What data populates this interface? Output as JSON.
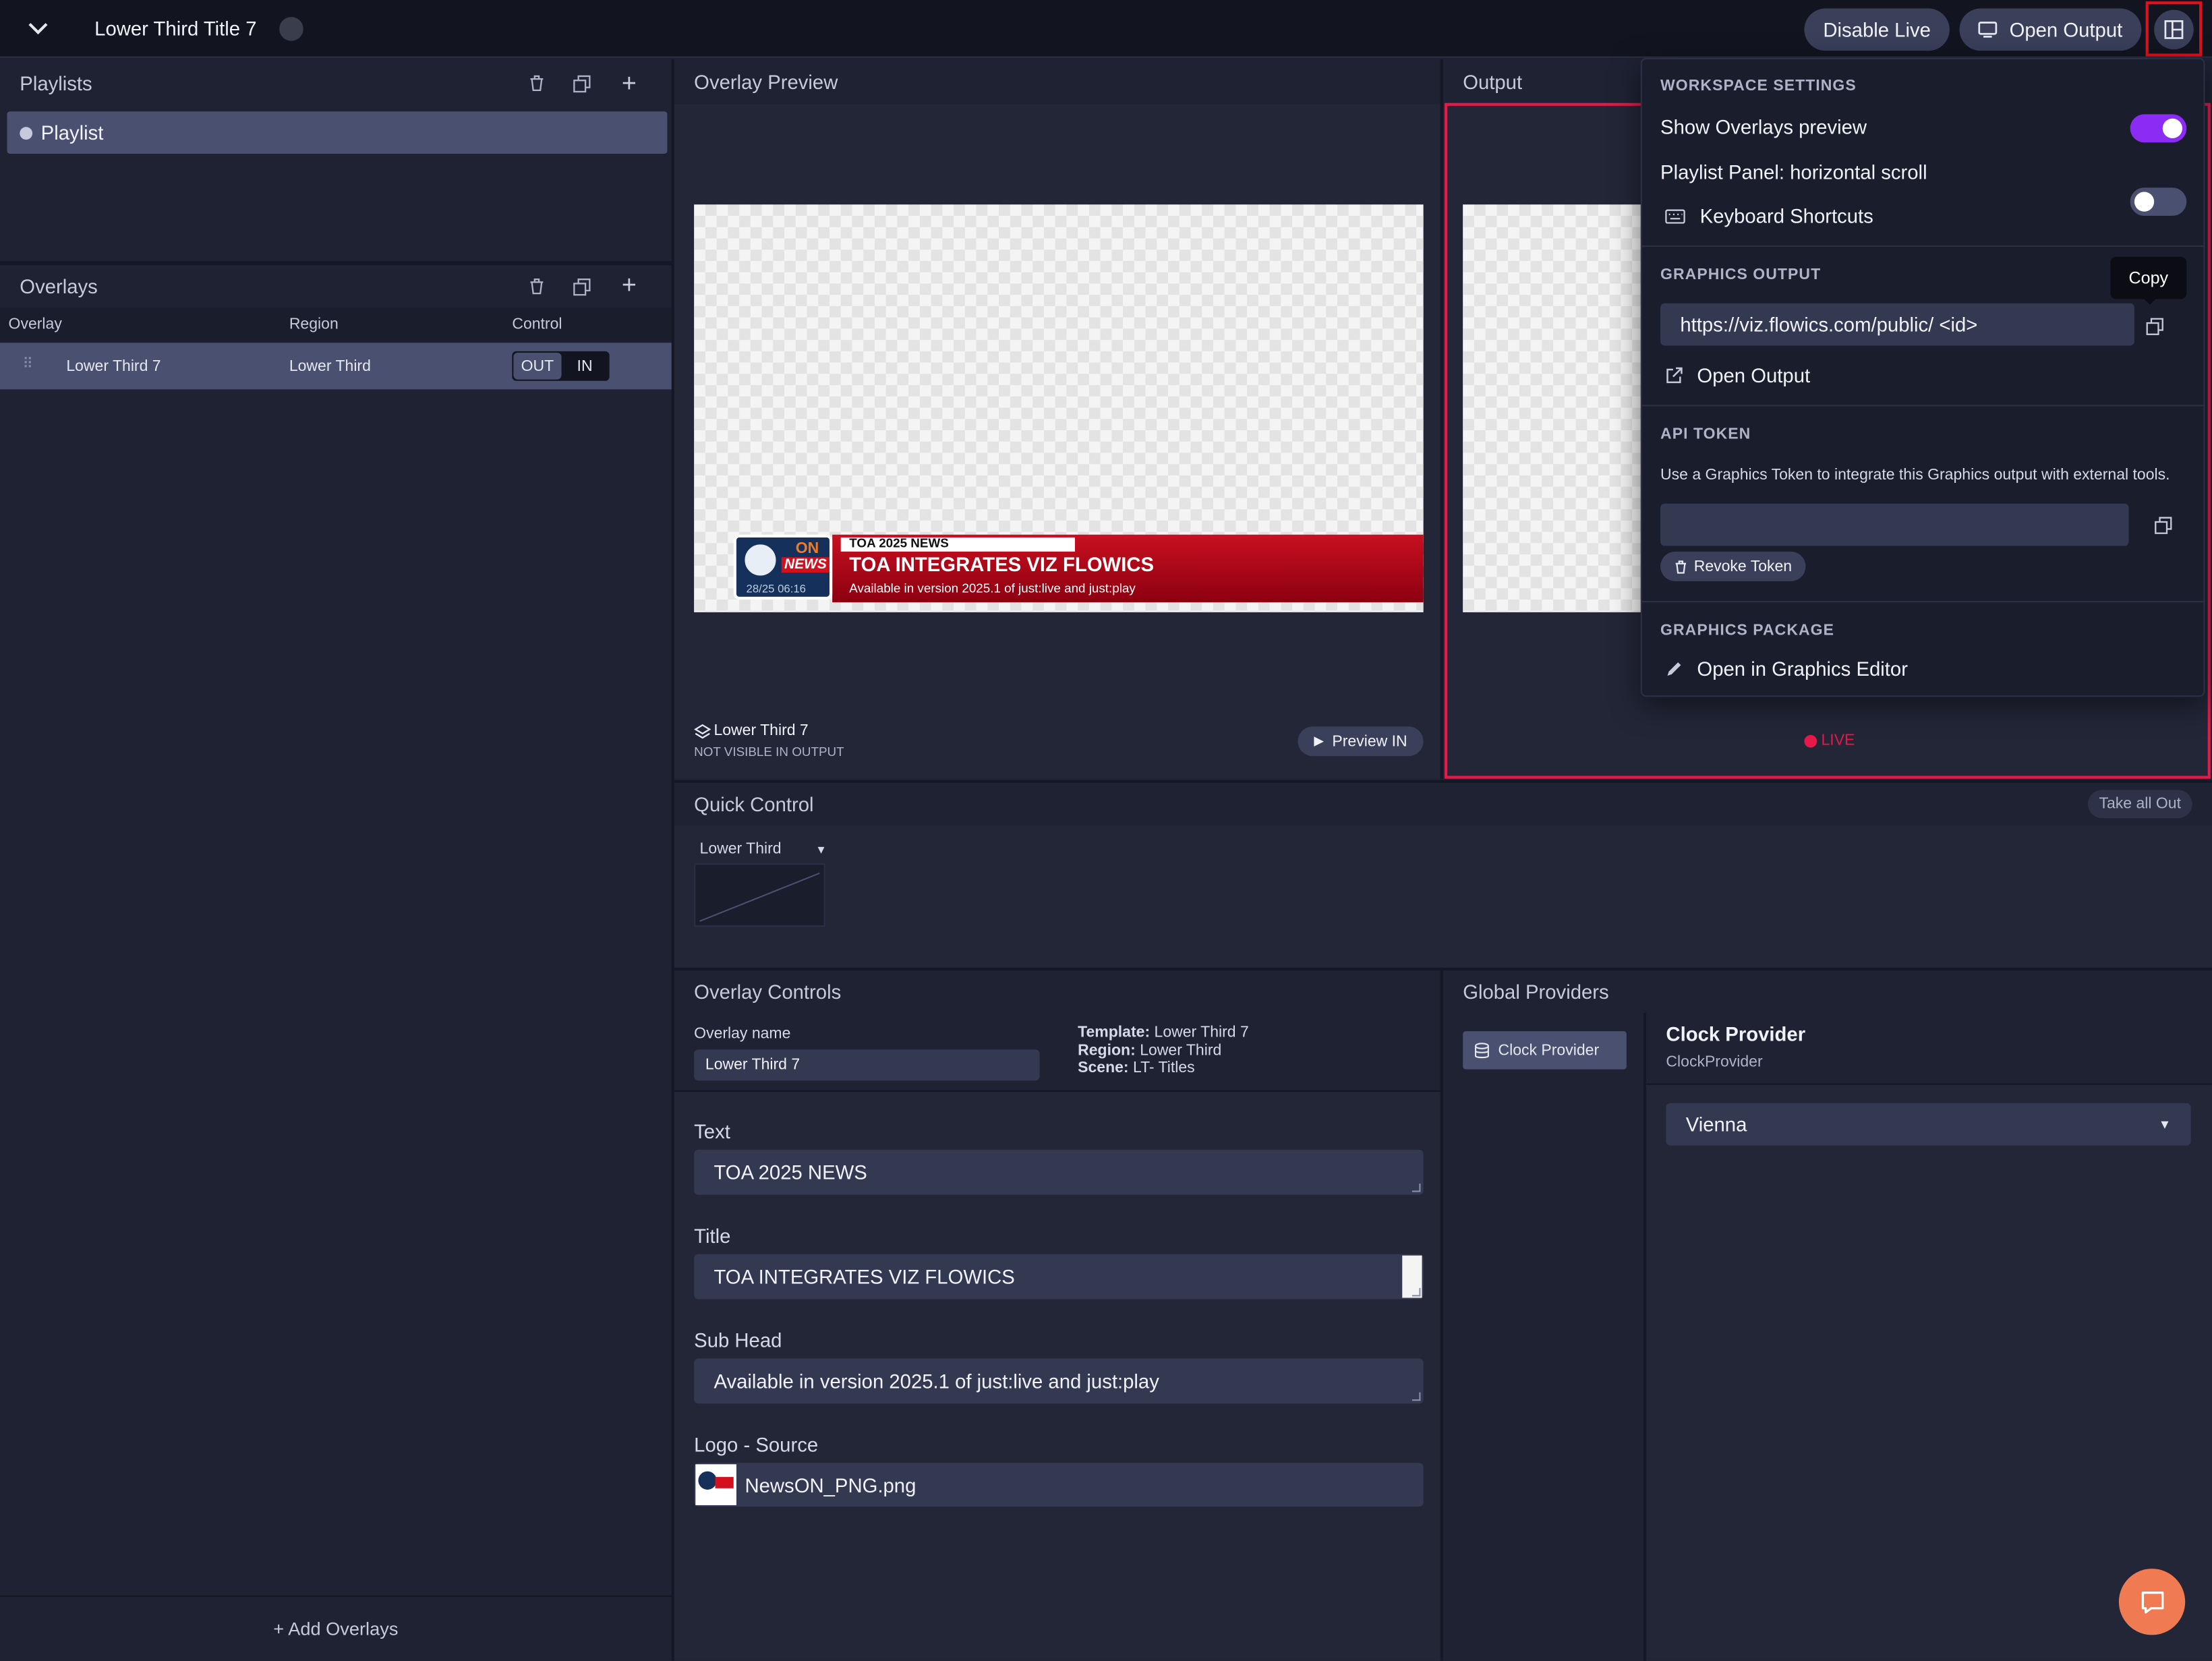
{
  "topbar": {
    "title": "Lower Third Title 7",
    "disable_live_label": "Disable Live",
    "open_output_label": "Open Output"
  },
  "playlists": {
    "header": "Playlists",
    "items": [
      {
        "label": "Playlist"
      }
    ]
  },
  "overlays": {
    "header": "Overlays",
    "columns": [
      "Overlay",
      "Region",
      "Control"
    ],
    "rows": [
      {
        "name": "Lower Third 7",
        "region": "Lower Third",
        "out_label": "OUT",
        "in_label": "IN"
      }
    ],
    "add_label": "+ Add Overlays"
  },
  "overlay_preview": {
    "header": "Overlay Preview",
    "overlay_name": "Lower Third 7",
    "status": "NOT VISIBLE IN OUTPUT",
    "preview_in_label": "Preview IN"
  },
  "lower_third_graphic": {
    "top_bar_text": "TOA 2025 NEWS",
    "headline": "TOA INTEGRATES VIZ FLOWICS",
    "subline": "Available in version 2025.1 of just:live and just:play",
    "logo_on": "ON",
    "logo_news": "NEWS",
    "logo_time": "28/25 06:16"
  },
  "output": {
    "header": "Output",
    "live_label": "LIVE"
  },
  "workspace_menu": {
    "workspace_title": "WORKSPACE SETTINGS",
    "show_overlays_preview": "Show Overlays preview",
    "show_overlays_preview_on": true,
    "playlist_horizontal_scroll": "Playlist Panel: horizontal scroll",
    "playlist_horizontal_scroll_on": false,
    "keyboard_shortcuts": "Keyboard Shortcuts",
    "graphics_output_title": "GRAPHICS OUTPUT",
    "copy_tooltip": "Copy",
    "output_url": "https://viz.flowics.com/public/ <id>",
    "open_output": "Open Output",
    "api_token_title": "API TOKEN",
    "api_token_desc": "Use a Graphics Token to integrate this Graphics output with external tools.",
    "api_token_value": "",
    "revoke_token": "Revoke Token",
    "graphics_package_title": "GRAPHICS PACKAGE",
    "open_graphics_editor": "Open in Graphics Editor"
  },
  "quick_control": {
    "header": "Quick Control",
    "take_all_out": "Take all Out",
    "dropdown_label": "Lower Third"
  },
  "overlay_controls": {
    "header": "Overlay Controls",
    "overlay_name_label": "Overlay name",
    "overlay_name_value": "Lower Third 7",
    "template_key": "Template:",
    "template_value": "Lower Third 7",
    "region_key": "Region:",
    "region_value": "Lower Third",
    "scene_key": "Scene:",
    "scene_value": "LT- Titles",
    "fields": [
      {
        "label": "Text",
        "value": "TOA 2025 NEWS"
      },
      {
        "label": "Title",
        "value": "TOA INTEGRATES VIZ FLOWICS"
      },
      {
        "label": "Sub Head",
        "value": "Available in version 2025.1 of just:live and just:play"
      }
    ],
    "logo_label": "Logo - Source",
    "logo_file": "NewsON_PNG.png"
  },
  "global_providers": {
    "header": "Global Providers",
    "provider_button": "Clock Provider",
    "provider_title": "Clock Provider",
    "provider_subtitle": "ClockProvider",
    "selected_timezone": "Vienna"
  },
  "colors": {
    "accent_purple": "#8b2cf5",
    "live_red": "#e5194a",
    "chat_orange": "#f07a52"
  }
}
